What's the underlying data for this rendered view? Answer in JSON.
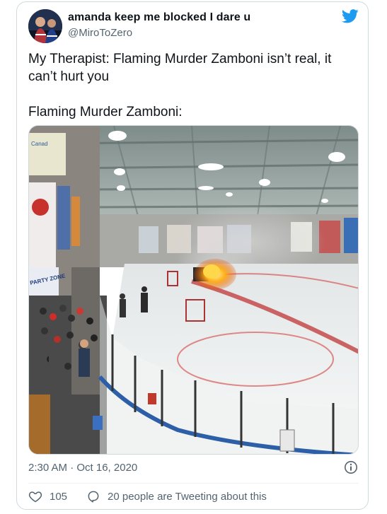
{
  "tweet": {
    "display_name": "amanda keep me blocked I dare u",
    "handle": "@MiroToZero",
    "text": "My Therapist: Flaming Murder Zamboni isn’t real, it can’t hurt you\n\nFlaming Murder Zamboni:",
    "timestamp": "2:30 AM · Oct 16, 2020",
    "like_count": "105",
    "reply_text": "20 people are Tweeting about this"
  },
  "media": {
    "signs": {
      "top_left": "Canad",
      "party_zone": "PARTY ZONE"
    }
  },
  "colors": {
    "twitter_blue": "#1d9bf0",
    "secondary_text": "#536471",
    "border": "#cfd9de"
  },
  "icons": {
    "brand": "twitter-bird-icon",
    "like": "heart-icon",
    "reply": "speech-bubble-icon",
    "info": "info-icon"
  }
}
